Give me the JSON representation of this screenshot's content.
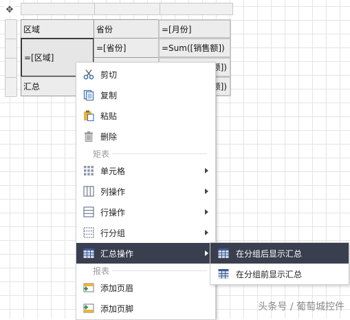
{
  "table": {
    "r1": {
      "c1": "区域",
      "c2": "省份",
      "c3": "=[月份]"
    },
    "r2": {
      "c1": "=[区域]",
      "c2": "=[省份]",
      "c3": "=Sum([销售额])"
    },
    "r3": {
      "c3": "额])"
    },
    "r4": {
      "c1": "汇总",
      "c3": "额])"
    }
  },
  "context_menu": {
    "cut": "剪切",
    "copy": "复制",
    "paste": "粘贴",
    "delete": "删除",
    "group_matrix": "矩表",
    "cell": "单元格",
    "column_ops": "列操作",
    "row_ops": "行操作",
    "row_group": "行分组",
    "summary_ops": "汇总操作",
    "group_report": "报表",
    "add_header": "添加页眉",
    "add_footer": "添加页脚"
  },
  "submenu": {
    "show_after": "在分组后显示汇总",
    "show_before": "在分组前显示汇总"
  },
  "watermark": "头条号 / 葡萄城控件",
  "colors": {
    "menu_active_bg": "#3a3f4f",
    "cell_bg": "#ececec",
    "icon_blue": "#3b6fb6",
    "icon_yellow": "#e8b53a"
  }
}
